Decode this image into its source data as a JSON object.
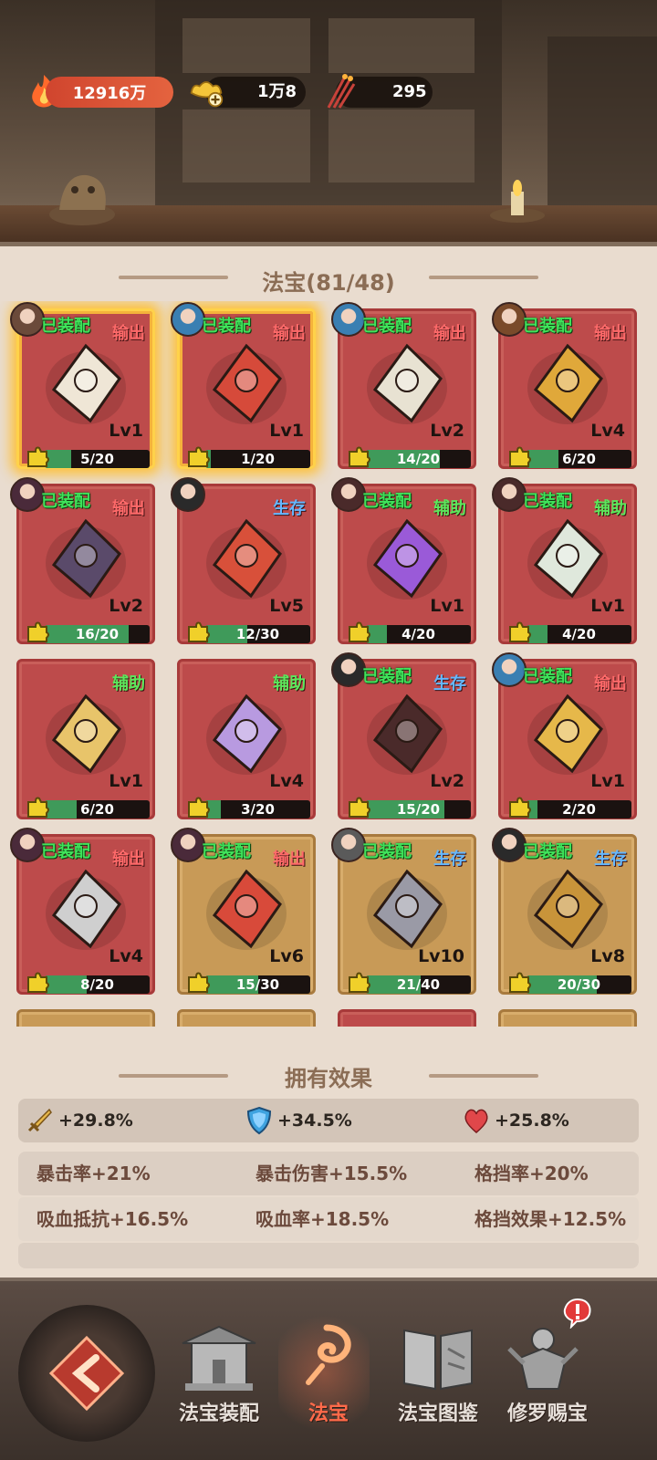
{
  "resources": {
    "power": "12916万",
    "gold": "1万8",
    "tokens": "295"
  },
  "section_title": "法宝(81/48)",
  "cards": [
    {
      "equipped": "已装配",
      "role": "输出",
      "role_type": "out",
      "level": "Lv1",
      "progress": "5/20",
      "fill": 0.25,
      "glow": true,
      "frame": "red",
      "item_icon": "harp-icon"
    },
    {
      "equipped": "已装配",
      "role": "输出",
      "role_type": "out",
      "level": "Lv1",
      "progress": "1/20",
      "fill": 0.05,
      "glow": true,
      "frame": "red",
      "item_icon": "armor-icon"
    },
    {
      "equipped": "已装配",
      "role": "输出",
      "role_type": "out",
      "level": "Lv2",
      "progress": "14/20",
      "fill": 0.7,
      "glow": false,
      "frame": "red",
      "item_icon": "drum-icon"
    },
    {
      "equipped": "已装配",
      "role": "输出",
      "role_type": "out",
      "level": "Lv4",
      "progress": "6/20",
      "fill": 0.3,
      "glow": false,
      "frame": "red",
      "item_icon": "vajra-icon"
    },
    {
      "equipped": "已装配",
      "role": "输出",
      "role_type": "out",
      "level": "Lv2",
      "progress": "16/20",
      "fill": 0.8,
      "glow": false,
      "frame": "red",
      "item_icon": "crossbow-icon"
    },
    {
      "equipped": "",
      "role": "生存",
      "role_type": "live",
      "level": "Lv5",
      "progress": "12/30",
      "fill": 0.4,
      "glow": false,
      "frame": "red",
      "item_icon": "robe-icon"
    },
    {
      "equipped": "已装配",
      "role": "辅助",
      "role_type": "aid",
      "level": "Lv1",
      "progress": "4/20",
      "fill": 0.2,
      "glow": false,
      "frame": "red",
      "item_icon": "crescent-blade-icon"
    },
    {
      "equipped": "已装配",
      "role": "辅助",
      "role_type": "aid",
      "level": "Lv1",
      "progress": "4/20",
      "fill": 0.2,
      "glow": false,
      "frame": "red",
      "item_icon": "jade-figure-icon"
    },
    {
      "equipped": "",
      "role": "辅助",
      "role_type": "aid",
      "level": "Lv1",
      "progress": "6/20",
      "fill": 0.3,
      "glow": false,
      "frame": "red",
      "item_icon": "book-icon"
    },
    {
      "equipped": "",
      "role": "辅助",
      "role_type": "aid",
      "level": "Lv4",
      "progress": "3/20",
      "fill": 0.15,
      "glow": false,
      "frame": "red",
      "item_icon": "lantern-icon"
    },
    {
      "equipped": "已装配",
      "role": "生存",
      "role_type": "live",
      "level": "Lv2",
      "progress": "15/20",
      "fill": 0.75,
      "glow": false,
      "frame": "red",
      "item_icon": "bat-mask-icon"
    },
    {
      "equipped": "已装配",
      "role": "输出",
      "role_type": "out",
      "level": "Lv1",
      "progress": "2/20",
      "fill": 0.1,
      "glow": false,
      "frame": "red",
      "item_icon": "dragon-seal-icon"
    },
    {
      "equipped": "已装配",
      "role": "输出",
      "role_type": "out",
      "level": "Lv4",
      "progress": "8/20",
      "fill": 0.4,
      "glow": false,
      "frame": "red",
      "item_icon": "axe-icon"
    },
    {
      "equipped": "已装配",
      "role": "输出",
      "role_type": "out",
      "level": "Lv6",
      "progress": "15/30",
      "fill": 0.5,
      "glow": false,
      "frame": "gold",
      "item_icon": "prayer-beads-icon"
    },
    {
      "equipped": "已装配",
      "role": "生存",
      "role_type": "live",
      "level": "Lv10",
      "progress": "21/40",
      "fill": 0.525,
      "glow": false,
      "frame": "gold",
      "item_icon": "talisman-icon"
    },
    {
      "equipped": "已装配",
      "role": "生存",
      "role_type": "live",
      "level": "Lv8",
      "progress": "20/30",
      "fill": 0.667,
      "glow": false,
      "frame": "gold",
      "item_icon": "shield-icon"
    }
  ],
  "effects": {
    "title": "拥有效果",
    "attack": "+29.8%",
    "defense": "+34.5%",
    "health": "+25.8%",
    "rows": [
      [
        "暴击率+21%",
        "暴击伤害+15.5%",
        "格挡率+20%"
      ],
      [
        "吸血抵抗+16.5%",
        "吸血率+18.5%",
        "格挡效果+12.5%"
      ]
    ]
  },
  "nav": {
    "equip": "法宝装配",
    "treasure": "法宝",
    "atlas": "法宝图鉴",
    "asura": "修罗赐宝"
  },
  "colors": {
    "card_red": "#bd4b4b",
    "card_gold": "#c89a57",
    "equipped_green": "#3fe35a",
    "role_output": "#ff6a6a",
    "role_survive": "#64b7ff",
    "role_support": "#5ce85c",
    "panel_bg": "#e9dccf"
  }
}
